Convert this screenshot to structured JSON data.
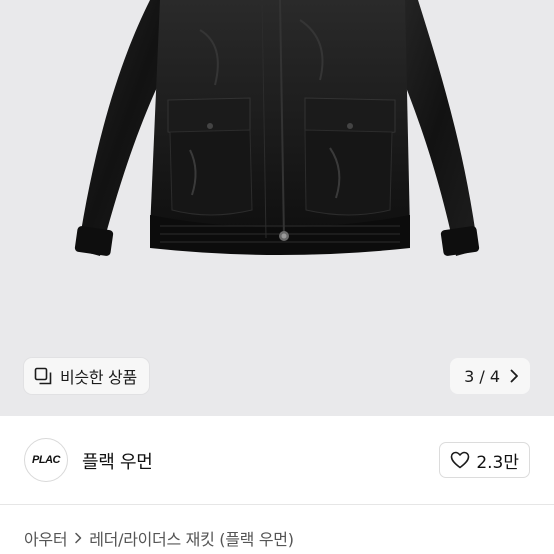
{
  "product_image": {
    "alt_icon": "black-leather-jacket-image"
  },
  "similar": {
    "label": "비슷한 상품",
    "icon": "similar-items-icon"
  },
  "pager": {
    "count": "3 / 4",
    "icon": "chevron-right-icon"
  },
  "seller": {
    "logo_text": "PLAC",
    "name": "플랙 우먼"
  },
  "like": {
    "count": "2.3만",
    "icon": "heart-outline-icon"
  },
  "breadcrumb": {
    "category": "아우터",
    "subcategory": "레더/라이더스 재킷 (플랙 우먼)"
  },
  "colors": {
    "image_bg": "#e9e9eb",
    "jacket": "#141414",
    "text": "#111111",
    "muted": "#555555"
  }
}
